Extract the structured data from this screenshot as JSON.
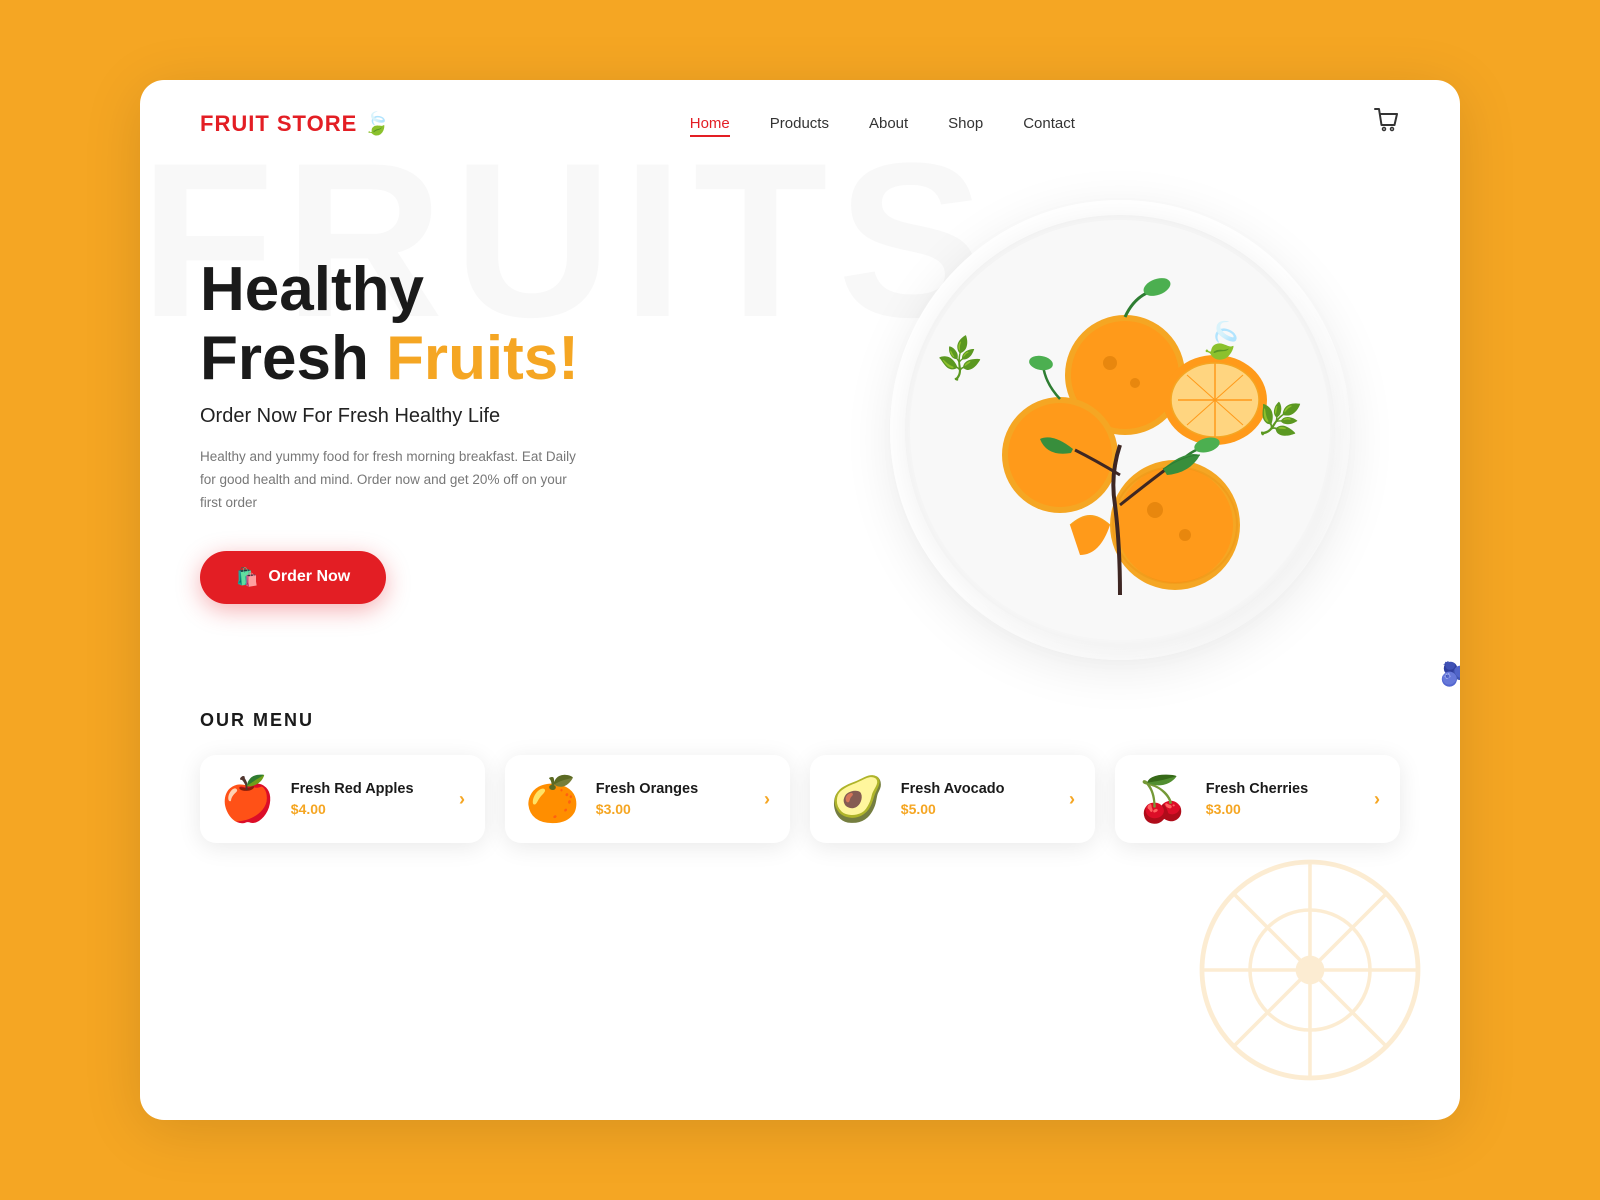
{
  "logo": {
    "brand": "FRUIT STORE",
    "leaf_emoji": "🍃"
  },
  "nav": {
    "items": [
      {
        "label": "Home",
        "active": true
      },
      {
        "label": "Products",
        "active": false
      },
      {
        "label": "About",
        "active": false
      },
      {
        "label": "Shop",
        "active": false
      },
      {
        "label": "Contact",
        "active": false
      }
    ]
  },
  "hero": {
    "title_line1": "Healthy",
    "title_line2_normal": "Fresh ",
    "title_line2_highlight": "Fruits!",
    "subtitle": "Order Now For Fresh Healthy Life",
    "description": "Healthy and yummy food for fresh morning breakfast. Eat Daily for good health and mind. Order now and get 20% off on your first order",
    "cta_label": "Order Now"
  },
  "menu": {
    "section_title": "OUR MENU",
    "items": [
      {
        "name": "Fresh Red Apples",
        "price": "$4.00",
        "emoji": "🍎"
      },
      {
        "name": "Fresh Oranges",
        "price": "$3.00",
        "emoji": "🍊"
      },
      {
        "name": "Fresh Avocado",
        "price": "$5.00",
        "emoji": "🥑"
      },
      {
        "name": "Fresh Cherries",
        "price": "$3.00",
        "emoji": "🍒"
      }
    ]
  },
  "background": {
    "watermark_text": "FRUITS",
    "orange_bg_color": "#F5A623"
  },
  "colors": {
    "brand_red": "#E31E24",
    "brand_orange": "#F5A623",
    "dark": "#1a1a1a",
    "nav_active": "#E31E24"
  }
}
